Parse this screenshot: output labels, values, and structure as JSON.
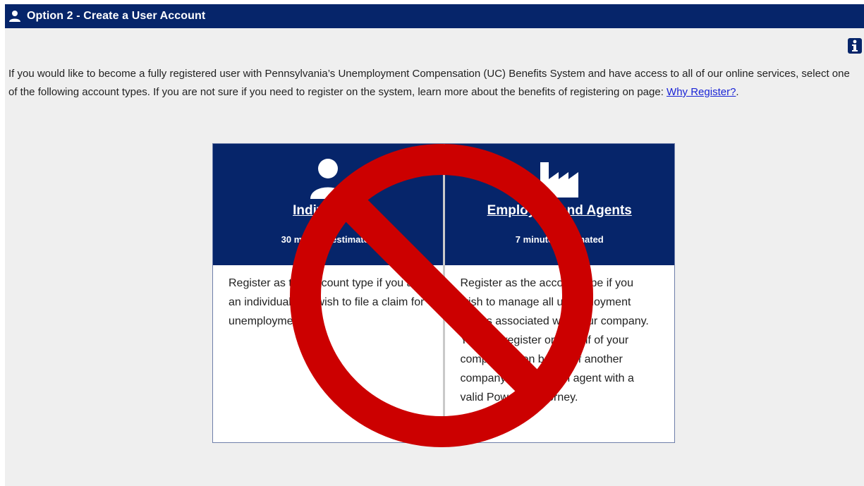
{
  "header": {
    "title": "Option 2 - Create a User Account",
    "icon": "user-icon"
  },
  "info": {
    "icon": "info-icon"
  },
  "intro": {
    "text": "If you would like to become a fully registered user with Pennsylvania’s Unemployment Compensation (UC) Benefits System and have access to all of our online services, select one of the following account types. If you are not sure if you need to register on the system, learn more about the benefits of registering on page: ",
    "link_text": "Why Register?",
    "trailing": "."
  },
  "cards": [
    {
      "icon": "person-icon",
      "title": "Individuals",
      "time": "30 minutes estimated",
      "description": "Register as this account type if you are an individual and wish to file a claim for unemployment."
    },
    {
      "icon": "factory-icon",
      "title": "Employers and Agents",
      "time": "7 minutes estimated",
      "description": "Register as the account type if you wish to manage all unemployment claims associated with your company. You can register on behalf of your company or on behalf of another company acting as an agent with a valid Power of Attorney."
    }
  ],
  "overlay": {
    "icon": "prohibited-icon",
    "color": "#cc0000"
  },
  "colors": {
    "brand": "#06256a",
    "background": "#efefef",
    "link": "#1a24d6"
  }
}
